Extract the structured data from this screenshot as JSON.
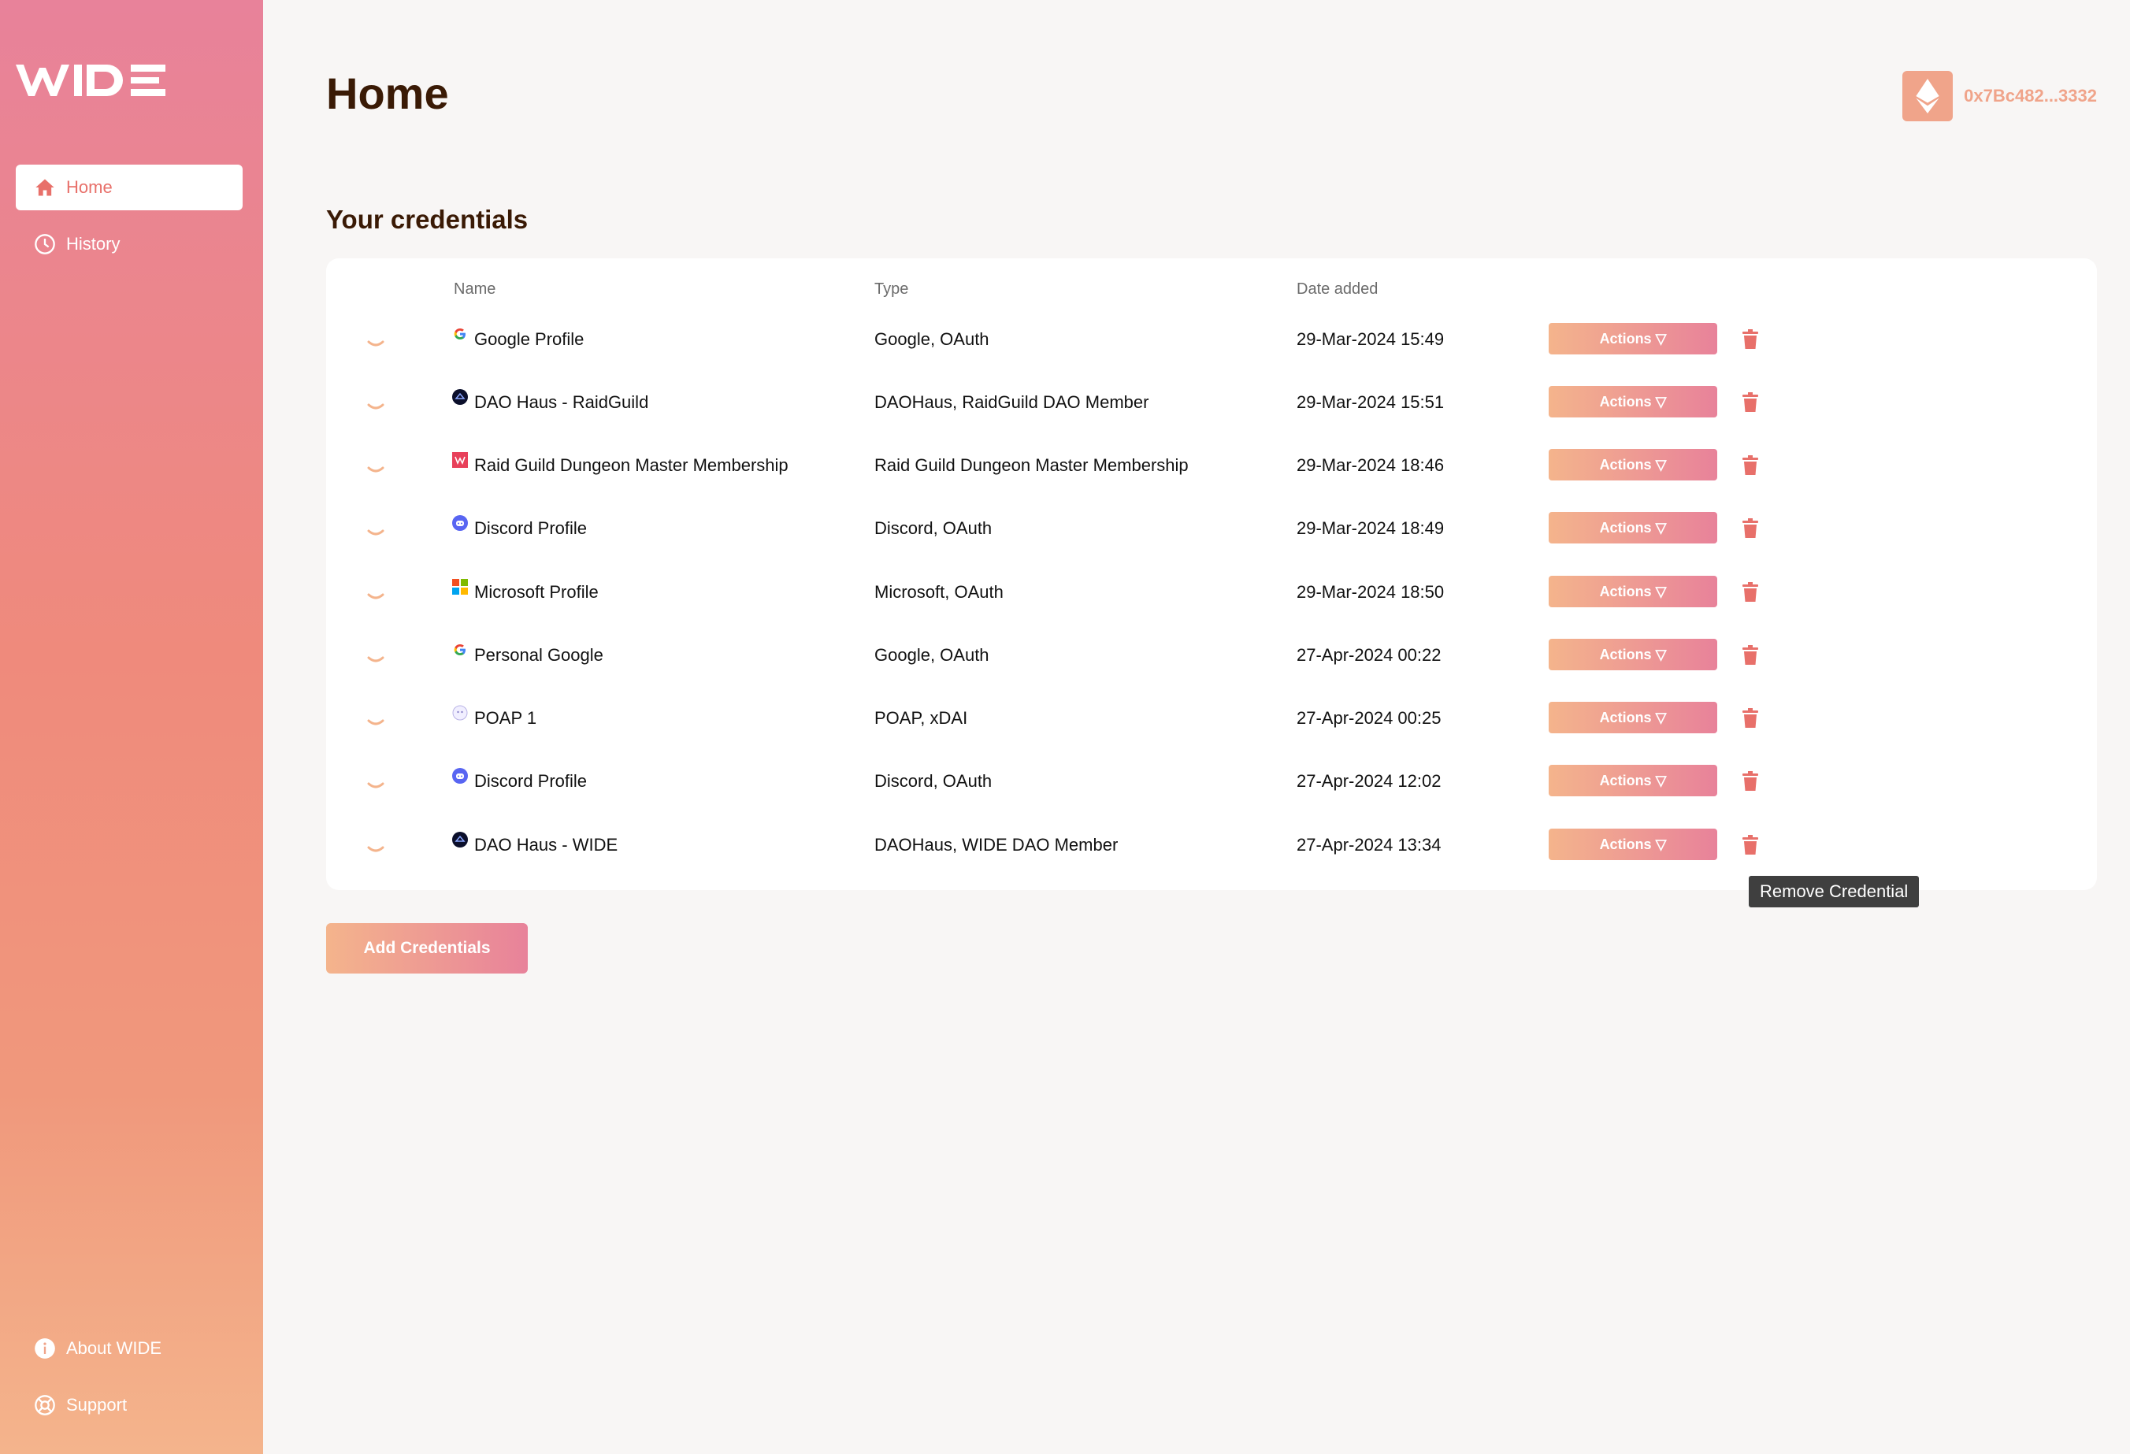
{
  "app": {
    "logo_text": "WIDE"
  },
  "sidebar": {
    "items": [
      {
        "label": "Home",
        "icon": "home-icon",
        "active": true
      },
      {
        "label": "History",
        "icon": "clock-icon",
        "active": false
      }
    ],
    "footer": [
      {
        "label": "About WIDE",
        "icon": "info-icon"
      },
      {
        "label": "Support",
        "icon": "lifebuoy-icon"
      }
    ]
  },
  "header": {
    "title": "Home",
    "wallet_address": "0x7Bc482...3332",
    "wallet_icon": "ethereum-icon"
  },
  "credentials": {
    "title": "Your credentials",
    "columns": {
      "name": "Name",
      "type": "Type",
      "date": "Date added"
    },
    "actions_label": "Actions ▽",
    "rows": [
      {
        "icon": "google-icon",
        "name": "Google Profile",
        "type": "Google, OAuth",
        "date": "29-Mar-2024 15:49"
      },
      {
        "icon": "daohaus-icon",
        "name": "DAO Haus - RaidGuild",
        "type": "DAOHaus, RaidGuild DAO Member",
        "date": "29-Mar-2024 15:51"
      },
      {
        "icon": "raidguild-icon",
        "name": "Raid Guild Dungeon Master Membership",
        "type": "Raid Guild Dungeon Master Membership",
        "date": "29-Mar-2024 18:46"
      },
      {
        "icon": "discord-icon",
        "name": "Discord Profile",
        "type": "Discord, OAuth",
        "date": "29-Mar-2024 18:49"
      },
      {
        "icon": "microsoft-icon",
        "name": "Microsoft Profile",
        "type": "Microsoft, OAuth",
        "date": "29-Mar-2024 18:50"
      },
      {
        "icon": "google-icon",
        "name": "Personal Google",
        "type": "Google, OAuth",
        "date": "27-Apr-2024 00:22"
      },
      {
        "icon": "poap-icon",
        "name": "POAP 1",
        "type": "POAP, xDAI",
        "date": "27-Apr-2024 00:25"
      },
      {
        "icon": "discord-icon",
        "name": "Discord Profile",
        "type": "Discord, OAuth",
        "date": "27-Apr-2024 12:02"
      },
      {
        "icon": "daohaus-icon",
        "name": "DAO Haus - WIDE",
        "type": "DAOHaus, WIDE DAO Member",
        "date": "27-Apr-2024 13:34"
      }
    ],
    "tooltip": "Remove Credential",
    "add_button": "Add Credentials"
  },
  "colors": {
    "accent": "#e8706a",
    "gradient_start": "#f4b48c",
    "gradient_end": "#e8829a",
    "title": "#3a1a05"
  }
}
